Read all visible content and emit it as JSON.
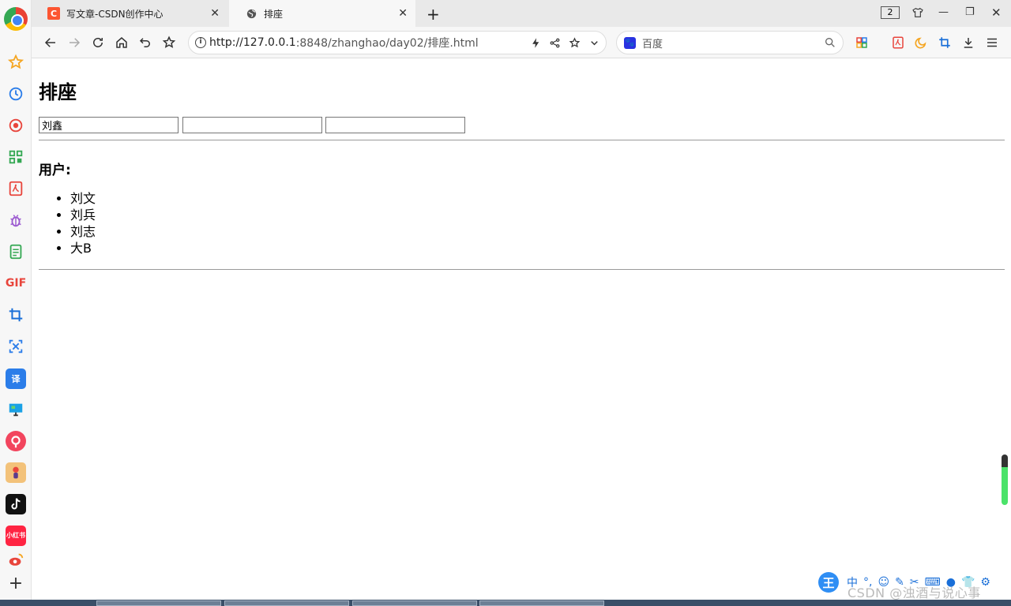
{
  "browser": {
    "tabs": [
      {
        "title": "写文章-CSDN创作中心",
        "favicon": "csdn-icon",
        "active": false
      },
      {
        "title": "排座",
        "favicon": "globe-icon",
        "active": true
      }
    ],
    "tab_count": "2",
    "address": {
      "host": "http://127.0.0.1",
      "rest": ":8848/zhanghao/day02/排座.html"
    },
    "search_engine": "百度",
    "accent": "#fc5531"
  },
  "sidebar": {
    "items": [
      "star-icon",
      "history-icon",
      "record-icon",
      "grid-icon",
      "pdf-icon",
      "bug-icon",
      "note-icon",
      "gif-icon",
      "crop-icon",
      "translate-icon",
      "translator-icon",
      "screen-icon",
      "cloud-icon",
      "game-icon",
      "tiktok-icon",
      "xiaohongshu-icon",
      "weibo-icon",
      "add-icon"
    ],
    "gif_label": "GIF",
    "translate_label": "译",
    "xhs_label": "小红书"
  },
  "page": {
    "title": "排座",
    "inputs": [
      "刘鑫",
      "",
      ""
    ],
    "users_heading": "用户:",
    "users": [
      "刘文",
      "刘兵",
      "刘志",
      "大B"
    ]
  },
  "ime": {
    "logo": "王",
    "mode": "中"
  },
  "watermark": "CSDN @浊酒与说心事"
}
